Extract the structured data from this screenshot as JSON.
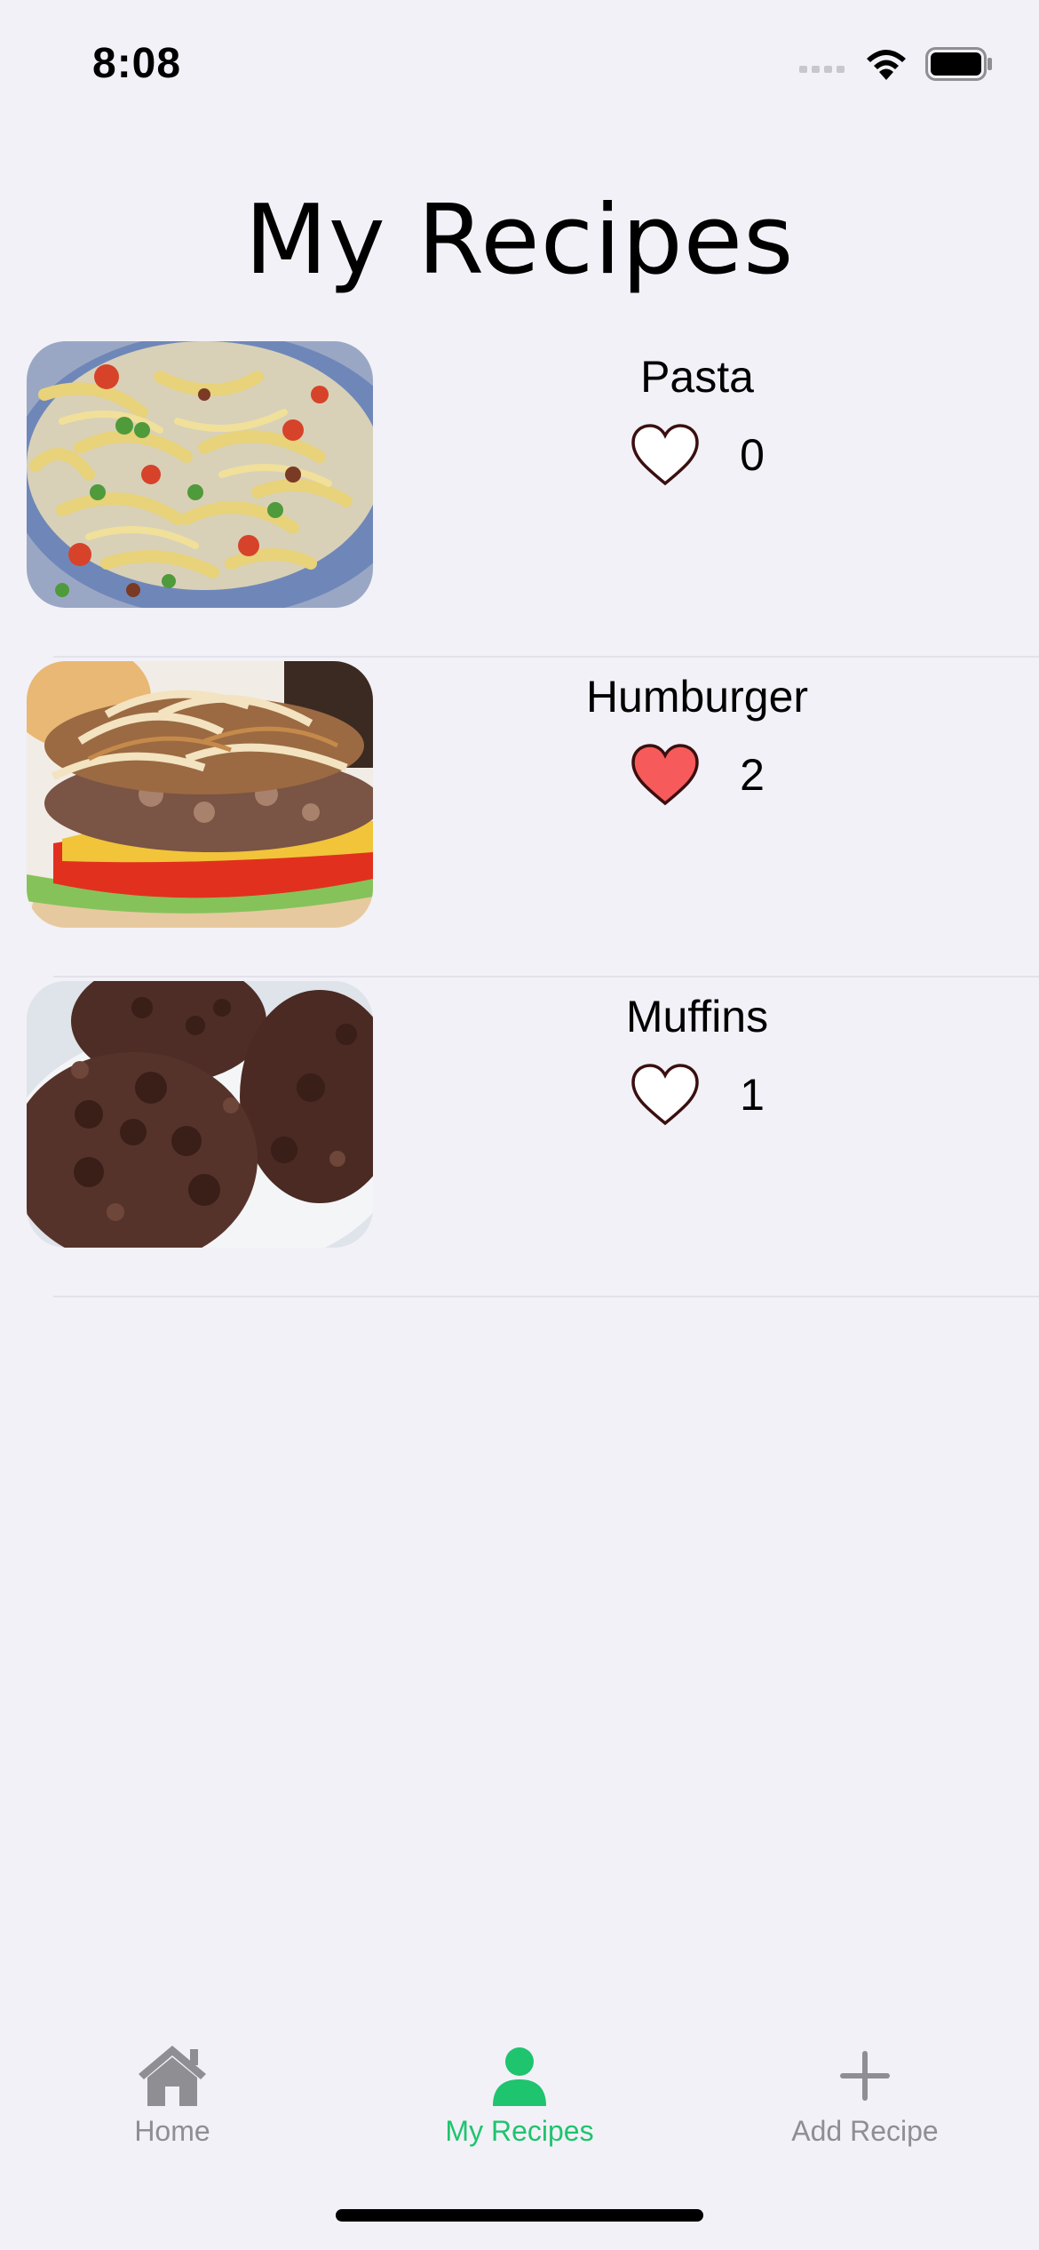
{
  "status_bar": {
    "time": "8:08"
  },
  "title": "My Recipes",
  "recipes": [
    {
      "name": "Pasta",
      "likes": "0",
      "liked": false,
      "image": "pasta-image"
    },
    {
      "name": "Humburger",
      "likes": "2",
      "liked": true,
      "image": "hamburger-image"
    },
    {
      "name": "Muffins",
      "likes": "1",
      "liked": false,
      "image": "muffins-image"
    }
  ],
  "tab_bar": {
    "items": [
      {
        "label": "Home",
        "icon": "house-icon",
        "selected": false
      },
      {
        "label": "My Recipes",
        "icon": "person-icon",
        "selected": true
      },
      {
        "label": "Add Recipe",
        "icon": "plus-icon",
        "selected": false
      }
    ]
  },
  "colors": {
    "background": "#f2f1f7",
    "accent": "#1ec46e",
    "heart_filled": "#f75a5a",
    "tab_inactive": "#8e8e93"
  }
}
